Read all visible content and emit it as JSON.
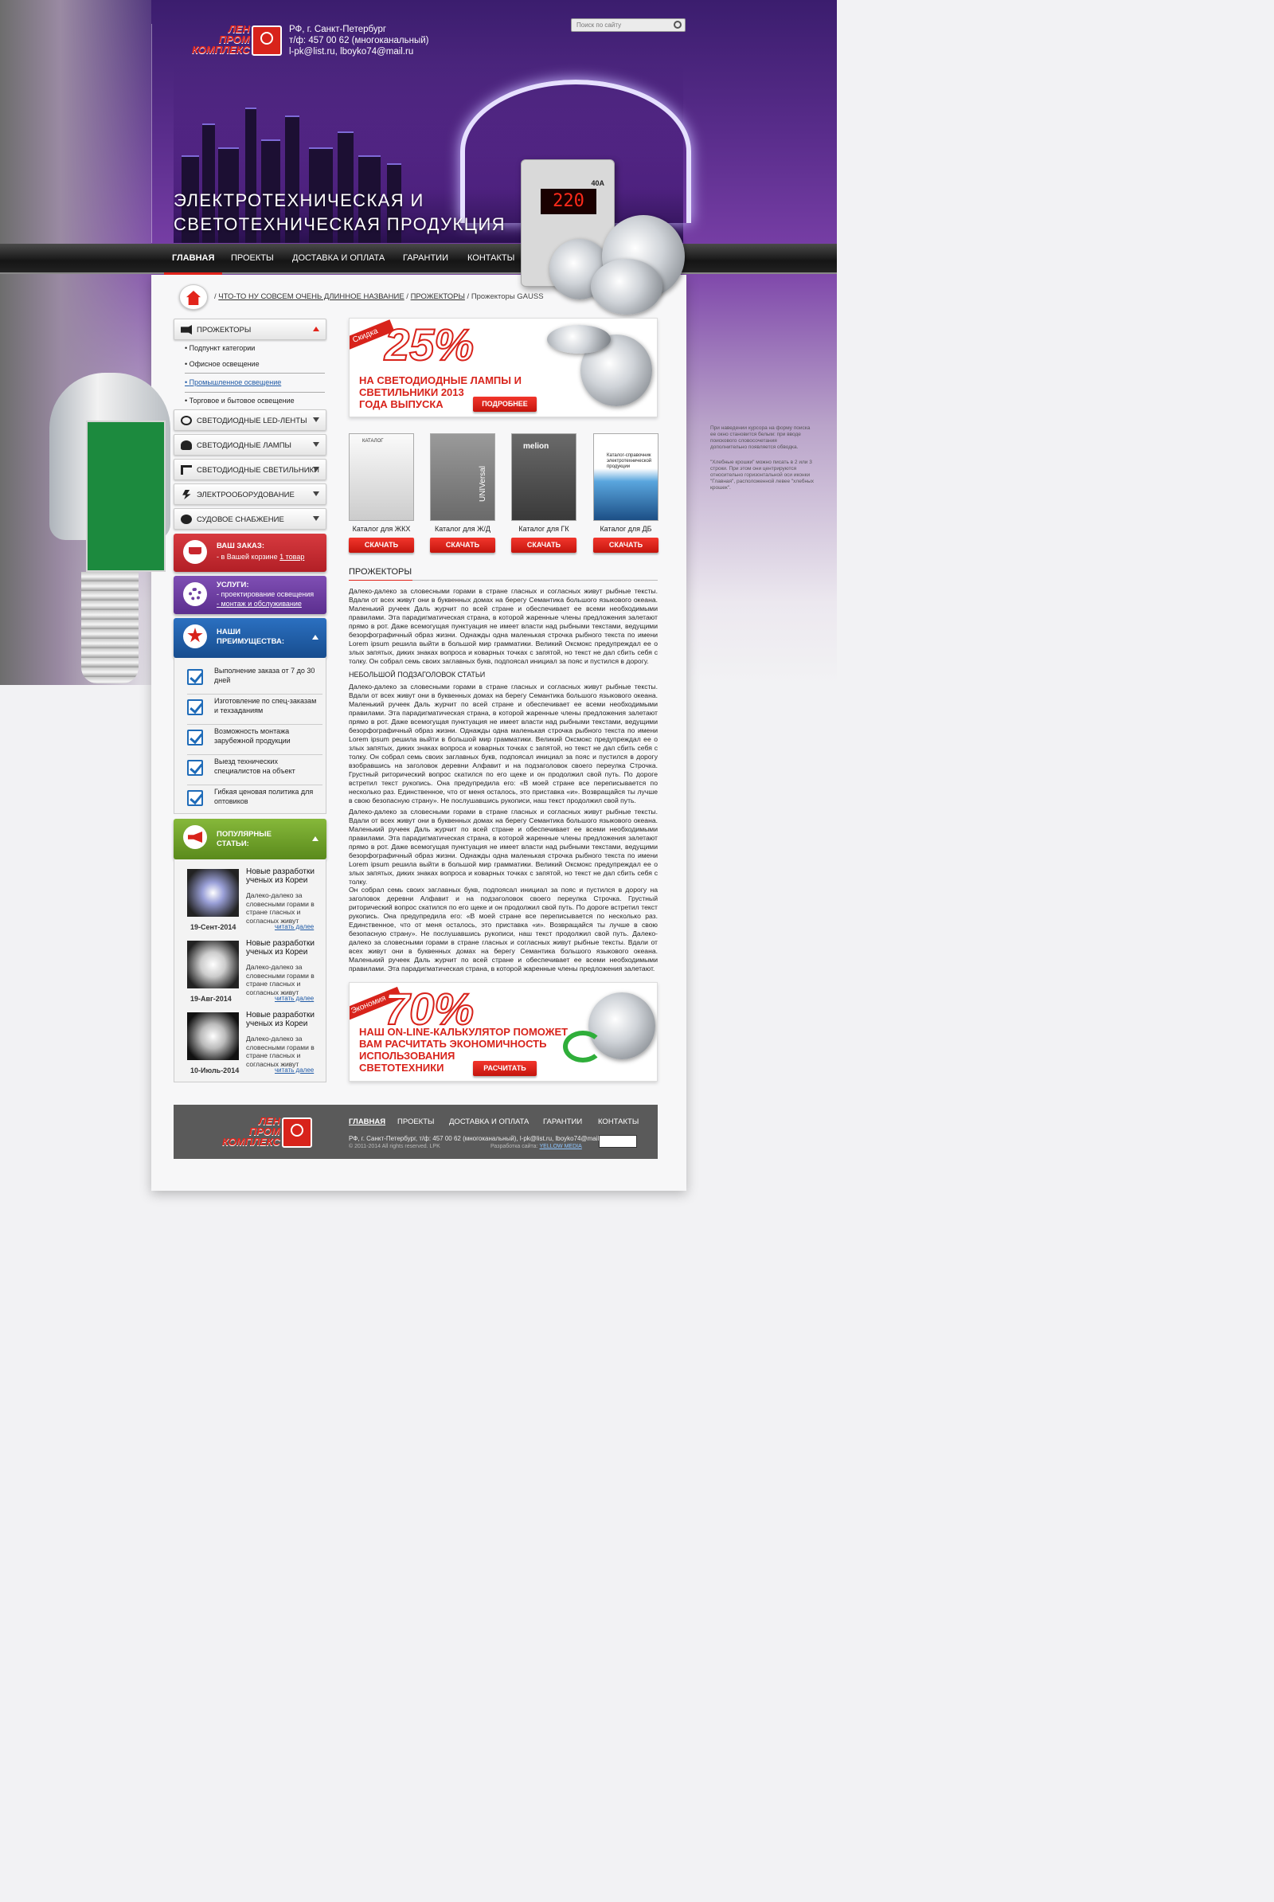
{
  "header": {
    "logo_text": [
      "ЛЕН",
      "ПРОМ",
      "КОМПЛЕКС"
    ],
    "contacts": [
      "РФ, г. Санкт-Петербург",
      "т/ф: 457 00 62 (многоканальный)",
      "l-pk@list.ru, lboyko74@mail.ru"
    ],
    "search_placeholder": "Поиск по сайту",
    "tagline": [
      "ЭЛЕКТРОТЕХНИЧЕСКАЯ  И",
      "СВЕТОТЕХНИЧЕСКАЯ  ПРОДУКЦИЯ"
    ],
    "device_display": "220",
    "device_amp": "40A"
  },
  "nav": [
    "ГЛАВНАЯ",
    "ПРОЕКТЫ",
    "ДОСТАВКА И ОПЛАТА",
    "ГАРАНТИИ",
    "КОНТАКТЫ"
  ],
  "breadcrumb": {
    "items": [
      "ЧТО-ТО НУ СОВСЕМ ОЧЕНЬ ДЛИННОЕ НАЗВАНИЕ",
      "ПРОЖЕКТОРЫ"
    ],
    "current": "Прожекторы GAUSS"
  },
  "sidebar": {
    "categories": [
      "ПРОЖЕКТОРЫ",
      "СВЕТОДИОДНЫЕ LED-ЛЕНТЫ",
      "СВЕТОДИОДНЫЕ ЛАМПЫ",
      "СВЕТОДИОДНЫЕ СВЕТИЛЬНИКИ",
      "ЭЛЕКТРООБОРУДОВАНИЕ",
      "СУДОВОЕ СНАБЖЕНИЕ"
    ],
    "subcategories": [
      "Подпункт категории",
      "Офисное освещение",
      "Промышленное освещение",
      "Торговое и бытовое освещение"
    ],
    "order": {
      "title": "ВАШ ЗАКАЗ:",
      "text": "- в Вашей корзине",
      "link": "1 товар"
    },
    "services": {
      "title": "УСЛУГИ:",
      "line1": "- проектирование освещения",
      "line2": "- монтаж и обслуживание"
    },
    "advantages": {
      "title": [
        "НАШИ",
        "ПРЕИМУЩЕСТВА:"
      ],
      "items": [
        "Выполнение заказа от 7 до 30 дней",
        "Изготовление по спец-заказам и техзаданиям",
        "Возможность монтажа зарубежной продукции",
        "Выезд технических специалистов на объект",
        "Гибкая ценовая политика для оптовиков"
      ]
    },
    "articles": {
      "title": [
        "ПОПУЛЯРНЫЕ",
        "СТАТЬИ:"
      ],
      "items": [
        {
          "title": "Новые разработки ученых из Кореи",
          "text": "Далеко-далеко за словесными горами в стране гласных и согласных живут",
          "date": "19-Сент-2014",
          "more": "читать далее"
        },
        {
          "title": "Новые разработки ученых из Кореи",
          "text": "Далеко-далеко за словесными горами в стране гласных и согласных живут",
          "date": "19-Авг-2014",
          "more": "читать далее"
        },
        {
          "title": "Новые разработки ученых из Кореи",
          "text": "Далеко-далеко за словесными горами в стране гласных и согласных живут",
          "date": "10-Июль-2014",
          "more": "читать далее"
        }
      ]
    }
  },
  "promo1": {
    "ribbon": "Скидка",
    "percent": "25%",
    "text": [
      "НА СВЕТОДИОДНЫЕ ЛАМПЫ И",
      "СВЕТИЛЬНИКИ 2013",
      "ГОДА ВЫПУСКА"
    ],
    "button": "ПОДРОБНЕЕ"
  },
  "catalogs": [
    {
      "name": "Каталог для ЖКХ",
      "cover": "КАТАЛОГ",
      "button": "СКАЧАТЬ"
    },
    {
      "name": "Каталог для Ж/Д",
      "cover": "UNIVersal",
      "button": "СКАЧАТЬ"
    },
    {
      "name": "Каталог для ГК",
      "cover": "melion",
      "button": "СКАЧАТЬ"
    },
    {
      "name": "Каталог для ДБ",
      "cover": "Каталог-справочник электротехнической продукции",
      "button": "СКАЧАТЬ"
    }
  ],
  "content": {
    "title": "ПРОЖЕКТОРЫ",
    "p1": "Далеко-далеко за словесными горами в стране гласных и согласных живут рыбные тексты. Вдали от всех живут они в буквенных домах на берегу Семантика большого языкового океана. Маленький ручеек Даль журчит по всей стране и обеспечивает ее всеми необходимыми правилами. Эта парадигматическая страна, в которой жаренные члены предложения залетают прямо в рот. Даже всемогущая пунктуация не имеет власти над рыбными текстами, ведущими безорфографичный образ жизни. Однажды одна маленькая строчка рыбного текста по имени Lorem ipsum решила выйти в большой мир грамматики. Великий Оксмокс предупреждал ее о злых запятых, диких знаках вопроса и коварных точках с запятой, но текст не дал сбить себя с толку. Он собрал семь своих заглавных букв, подпоясал инициал за пояс и пустился в дорогу.",
    "subheading": "НЕБОЛЬШОЙ ПОДЗАГОЛОВОК СТАТЬИ",
    "p2": "Далеко-далеко за словесными горами в стране гласных и согласных живут рыбные тексты. Вдали от всех живут они в буквенных домах на берегу Семантика большого языкового океана. Маленький ручеек Даль журчит по всей стране и обеспечивает ее всеми необходимыми правилами. Эта парадигматическая страна, в которой жаренные члены предложения залетают прямо в рот. Даже всемогущая пунктуация не имеет власти над рыбными текстами, ведущими безорфографичный образ жизни. Однажды одна маленькая строчка рыбного текста по имени Lorem ipsum решила выйти в большой мир грамматики. Великий Оксмокс предупреждал ее о злых запятых, диких знаках вопроса и коварных точках с запятой, но текст не дал сбить себя с толку. Он собрал семь своих заглавных букв, подпоясал инициал за пояс и пустился в дорогу взобравшись на заголовок деревни Алфавит и на подзаголовок своего переулка Строчка. Грустный риторический вопрос скатился по его щеке и он продолжил свой путь. По дороге встретил текст рукопись. Она предупредила его: «В моей стране все переписывается по несколько раз. Единственное, что от меня осталось, это приставка «и». Возвращайся ты лучше в свою безопасную страну». Не послушавшись рукописи, наш текст продолжил свой путь.",
    "p3": "Далеко-далеко за словесными горами в стране гласных и согласных живут рыбные тексты. Вдали от всех живут они в буквенных домах на берегу Семантика большого языкового океана. Маленький ручеек Даль журчит по всей стране и обеспечивает ее всеми необходимыми правилами. Эта парадигматическая страна, в которой жаренные члены предложения залетают прямо в рот. Даже всемогущая пунктуация не имеет власти над рыбными текстами, ведущими безорфографичный образ жизни. Однажды одна маленькая строчка рыбного текста по имени Lorem ipsum решила выйти в большой мир грамматики. Великий Оксмокс предупреждал ее о злых запятых, диких знаках вопроса и коварных точках с запятой, но текст не дал сбить себя с толку.",
    "p4": "Он собрал семь своих заглавных букв, подпоясал инициал за пояс и пустился в дорогу на заголовок деревни Алфавит и на подзаголовок своего переулка Строчка. Грустный риторический вопрос скатился по его щеке и он продолжил свой путь. По дороге встретил текст рукопись. Она предупредила его: «В моей стране все переписывается по несколько раз. Единственное, что от меня осталось, это приставка «и». Возвращайся ты лучше в свою безопасную страну». Не послушавшись рукописи, наш текст продолжил свой путь. Далеко-далеко за словесными горами в стране гласных и согласных живут рыбные тексты. Вдали от всех живут они в буквенных домах на берегу Семантика большого языкового океана. Маленький ручеек Даль журчит по всей стране и обеспечивает ее всеми необходимыми правилами. Эта парадигматическая страна, в которой жаренные члены предложения залетают."
  },
  "promo2": {
    "ribbon": "Экономия",
    "percent": "70%",
    "text": [
      "НАШ ON-LINE-КАЛЬКУЛЯТОР ПОМОЖЕТ",
      "ВАМ РАСЧИТАТЬ ЭКОНОМИЧНОСТЬ",
      "ИСПОЛЬЗОВАНИЯ",
      "СВЕТОТЕХНИКИ"
    ],
    "button": "РАСЧИТАТЬ"
  },
  "footer": {
    "nav": [
      "ГЛАВНАЯ",
      "ПРОЕКТЫ",
      "ДОСТАВКА И ОПЛАТА",
      "ГАРАНТИИ",
      "КОНТАКТЫ"
    ],
    "info": "РФ, г. Санкт-Петербург, т/ф: 457 00 62 (многоканальный), l-pk@list.ru, lboyko74@mail.ru",
    "copyright": "© 2011-2014 All rights reserved.  LPK",
    "dev_label": "Разработка сайта:",
    "dev_link": "YELLOW MEDIA"
  },
  "notes": [
    "При наведении курсора на форму поиска ее окно становится белым: при вводе поискового словосочетания дополнительно появляется обводка.",
    "\"Хлебные крошки\" можно писать в 2 или 3 строки. При этом они центрируются относительно горизонтальной оси иконки \"Главная\", расположенной левее \"хлебных крошек\"."
  ],
  "colors": {
    "accent": "#e2241b",
    "order_box": "#c8262d",
    "services_box": "#6f3fa3",
    "advantages_box": "#1e5ea8",
    "articles_box": "#6f9e23"
  }
}
